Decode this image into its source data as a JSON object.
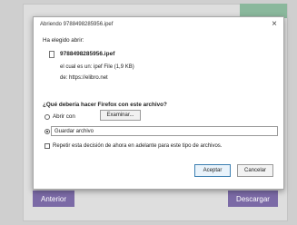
{
  "background": {
    "green_button": "",
    "prev_label": "Anterior",
    "next_label": "Descargar"
  },
  "dialog": {
    "title": "Abriendo 9788498285956.ipef",
    "close_glyph": "×",
    "intro": "Ha elegido abrir:",
    "file_name": "9788498285956.ipef",
    "file_type": "el cual es un: ipef File (1,9 KB)",
    "file_source": "de: https://elibro.net",
    "question": "¿Qué debería hacer Firefox con este archivo?",
    "open_with_label": "Abrir con",
    "browse_label": "Examinar...",
    "save_label": "Guardar archivo",
    "repeat_label": "Repetir esta decisión de ahora en adelante para este tipo de archivos.",
    "accept_label": "Aceptar",
    "cancel_label": "Cancelar"
  }
}
